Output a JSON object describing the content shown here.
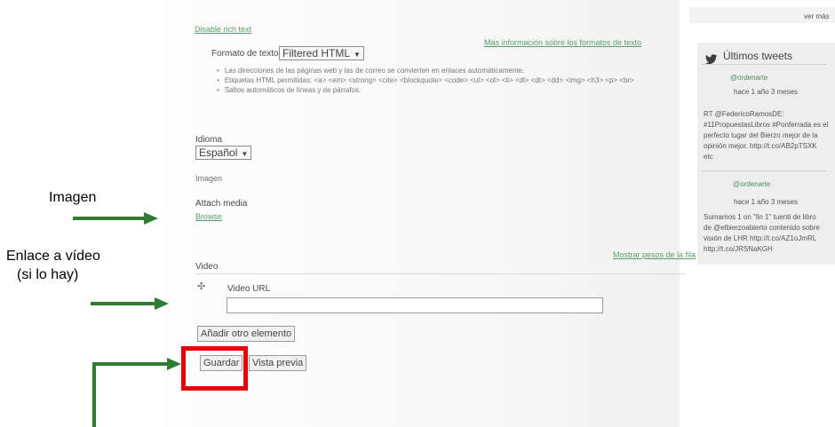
{
  "annotations": {
    "imagen_label": "Imagen",
    "video_label_line1": "Enlace a  vídeo",
    "video_label_line2": "(si lo hay)",
    "arrow_color": "#2e7d32",
    "highlight_color": "#e60000"
  },
  "form": {
    "disable_rich_text": "Disable rich text",
    "text_format_label": "Formato de texto:",
    "text_format_value": "Filtered HTML",
    "more_info_link": "Más información sobre los formatos de texto",
    "format_tips": [
      "Las direcciones de las páginas web y las de correo se convierten en enlaces automáticamente.",
      "Etiquetas HTML permitidas: <a> <em> <strong> <cite> <blockquote> <code> <ul> <ol> <li> <dl> <dt> <dd> <img> <h3> <p> <br>",
      "Saltos automáticos de líneas y de párrafos."
    ],
    "language_label": "Idioma",
    "language_value": "Español",
    "image_label": "Imagen",
    "attach_media_label": "Attach media",
    "attach_media_link": "Browse",
    "show_row_weights": "Mostrar pesos de la fila",
    "video_section_label": "Video",
    "video_url_label": "Video URL",
    "video_url_value": "",
    "add_item_button": "Añadir otro elemento",
    "save_button": "Guardar",
    "preview_button": "Vista previa"
  },
  "sidebar": {
    "top_text": "ver más",
    "tweets_title": "Últimos tweets",
    "tweets": [
      {
        "user": "@ordenarte",
        "time": "hace 1 año 3 meses",
        "lines": [
          "RT @FedericoRamosDE:",
          "#11PropuestasLibros #Ponferrada es el",
          "perfecto lugar del Bierzo mejor de la",
          "opinión mejor. http://t.co/AB2pTSXK",
          "etc"
        ]
      },
      {
        "user": "@ordenarte",
        "time": "hace 1 año 3 meses",
        "lines": [
          "Sumamos 1 on \"lln 1\" tuenti de libro",
          "de @elbierzoabierto contenido sobre",
          "visión de LHR http://t.co/AZ1oJmRL",
          "http://t.co/JRSNaKGH"
        ]
      }
    ]
  }
}
